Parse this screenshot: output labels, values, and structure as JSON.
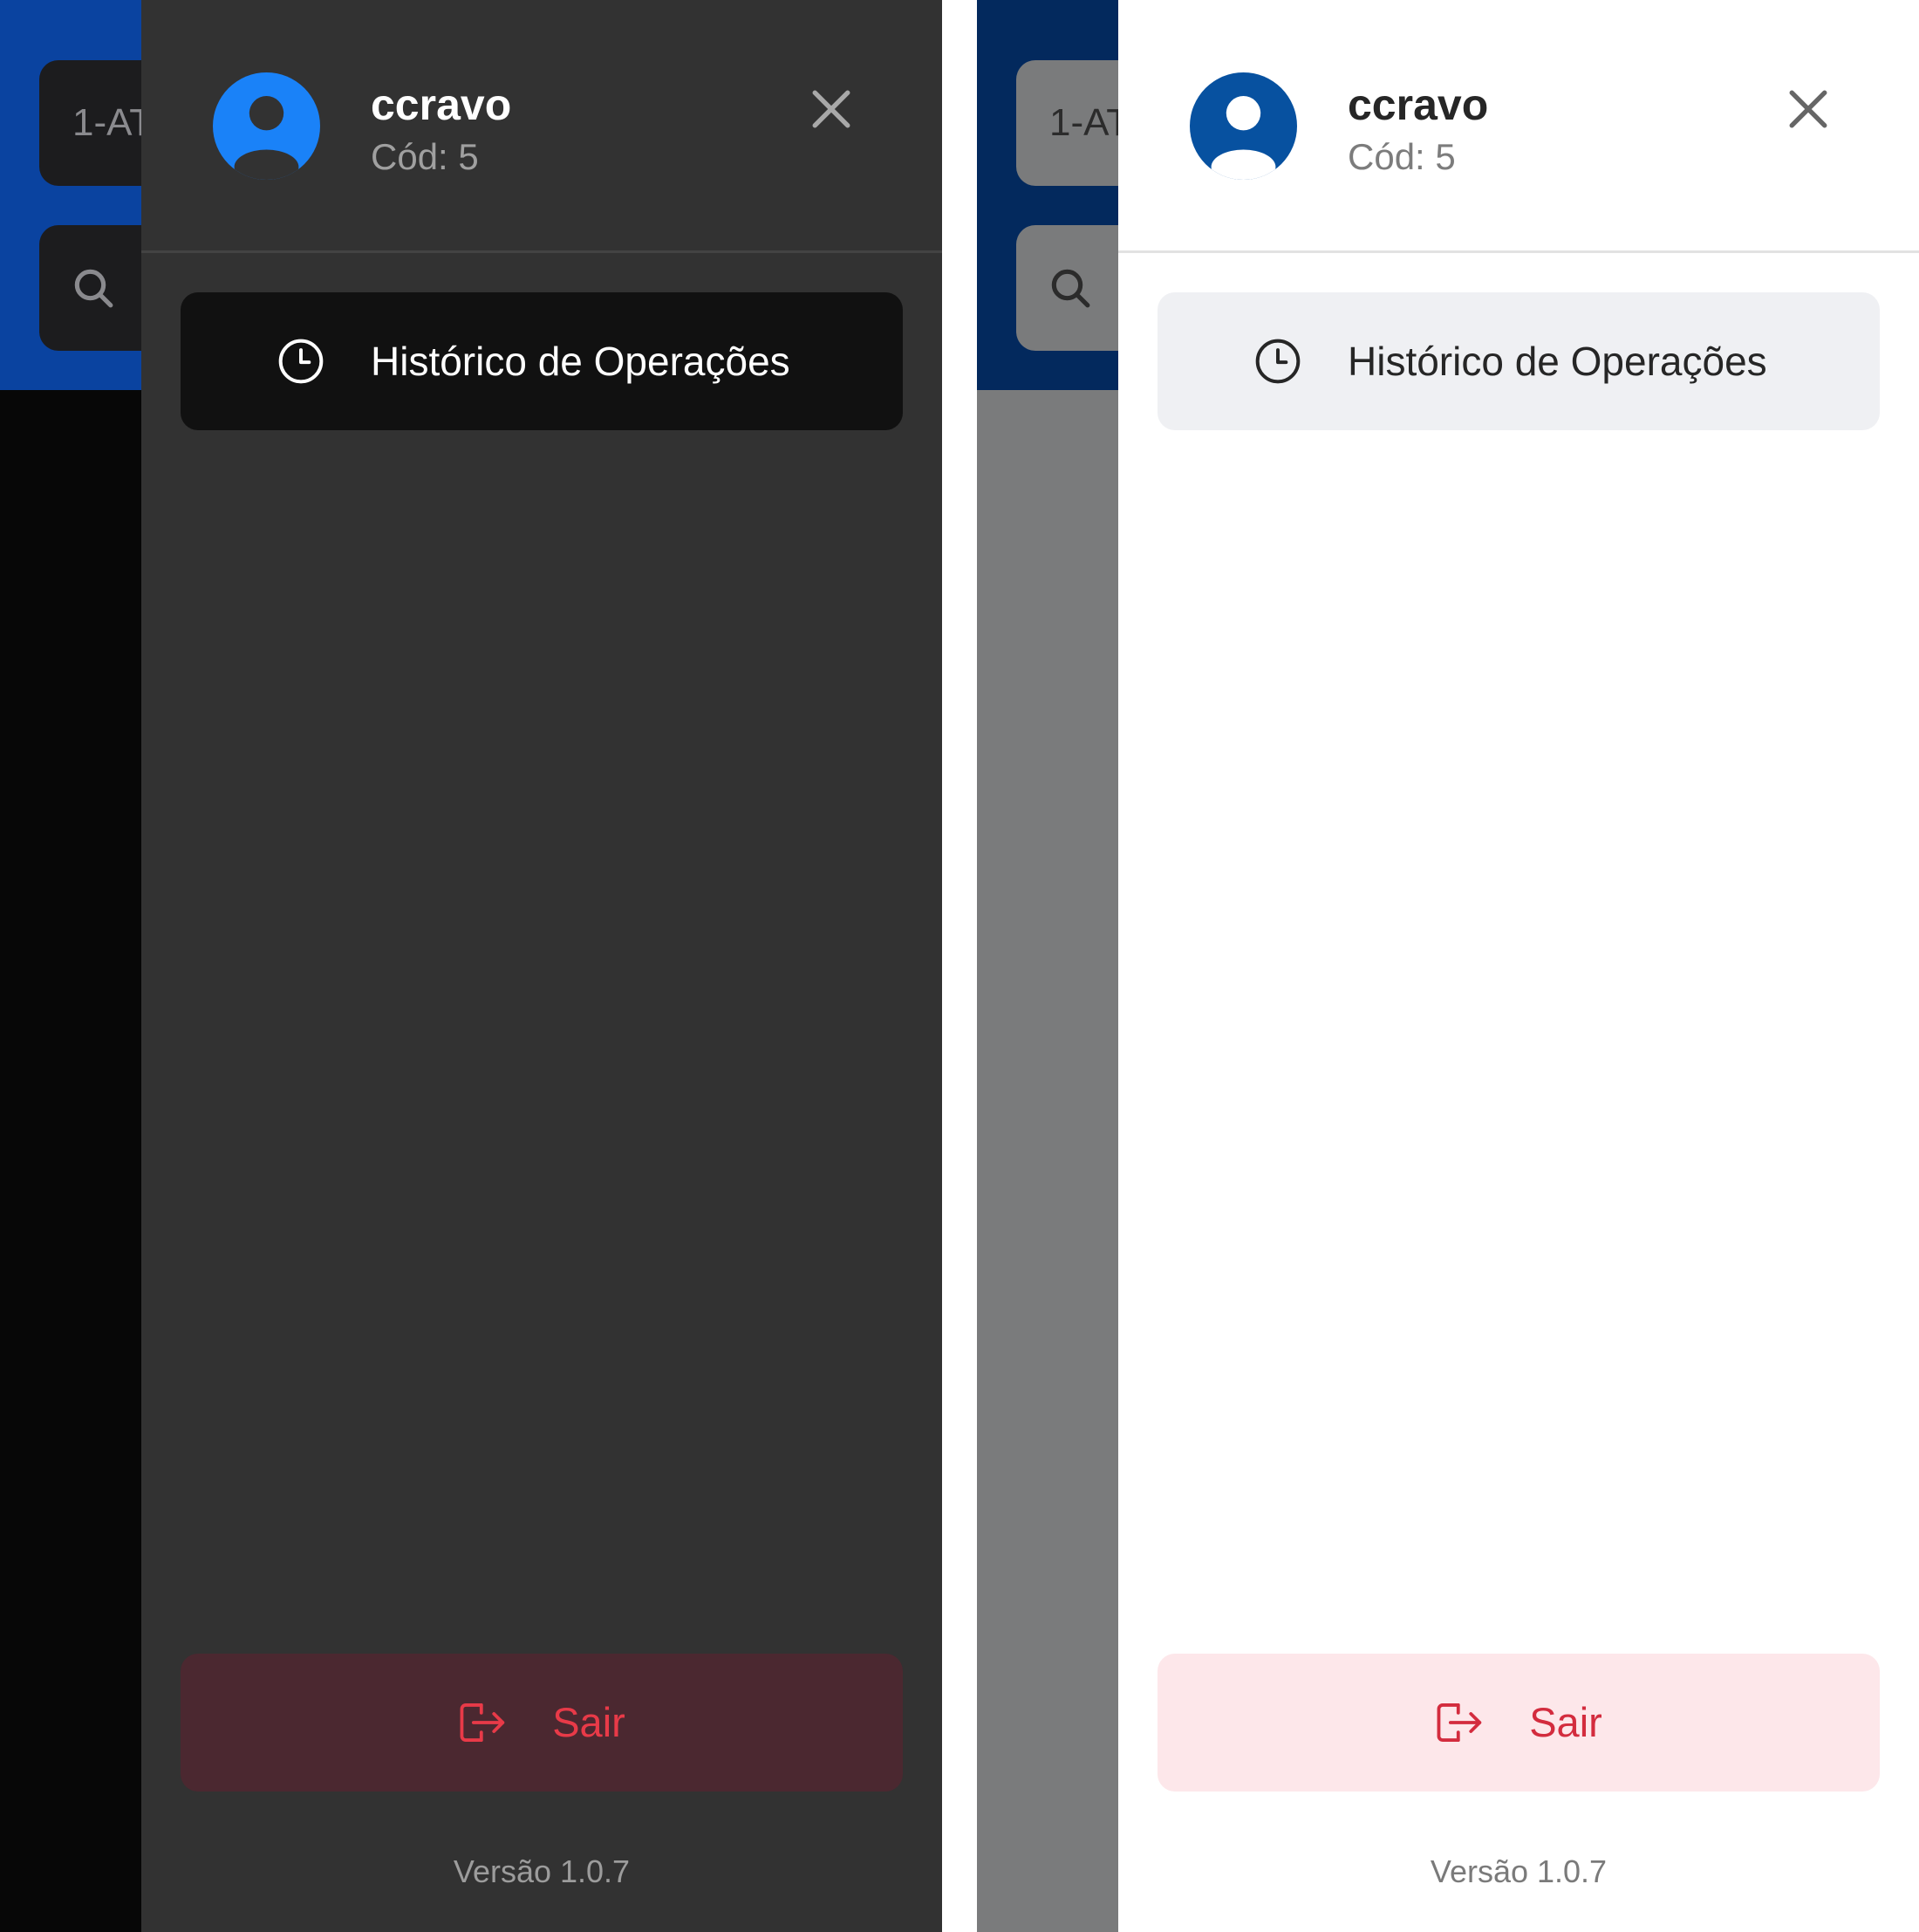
{
  "screens": [
    {
      "theme": "dark",
      "background_app": {
        "route_field_text": "1-AT"
      },
      "drawer": {
        "user": {
          "name": "ccravo",
          "code": "Cód: 5"
        },
        "menu_items": [
          {
            "label": "Histórico de Operações",
            "icon": "clock-icon"
          }
        ],
        "logout": {
          "label": "Sair",
          "icon": "logout-icon"
        },
        "version": "Versão 1.0.7",
        "colors": {
          "accent": "#1a82f8",
          "logout": "#e83a48"
        }
      }
    },
    {
      "theme": "light",
      "background_app": {
        "route_field_text": "1-AT"
      },
      "drawer": {
        "user": {
          "name": "ccravo",
          "code": "Cód: 5"
        },
        "menu_items": [
          {
            "label": "Histórico de Operações",
            "icon": "clock-icon"
          }
        ],
        "logout": {
          "label": "Sair",
          "icon": "logout-icon"
        },
        "version": "Versão 1.0.7",
        "colors": {
          "accent": "#0751a0",
          "logout": "#d32c3e"
        }
      }
    }
  ]
}
